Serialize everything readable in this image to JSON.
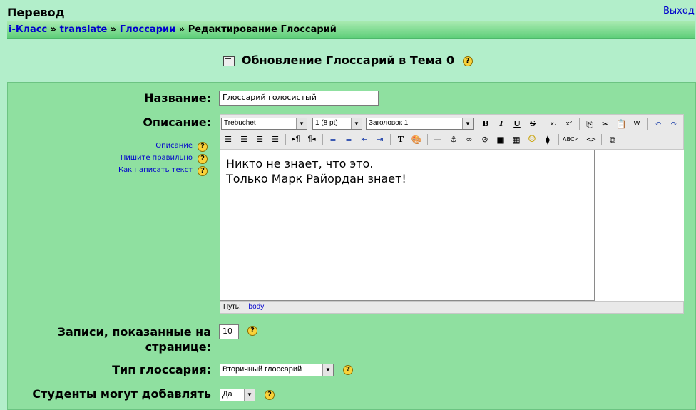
{
  "header": {
    "site_title": "Перевод",
    "logout_label": "Выход"
  },
  "breadcrumb": {
    "items": [
      "i-Класс",
      "translate",
      "Глоссарии"
    ],
    "separator": "»",
    "current": "Редактирование Глоссарий"
  },
  "page": {
    "heading": "Обновление Глоссарий в Тема 0"
  },
  "form": {
    "name_label": "Название:",
    "name_value": "Глоссарий голосистый",
    "description_label": "Описание:",
    "help_links": [
      "Описание",
      "Пишите правильно",
      "Как написать текст"
    ],
    "entries_label_line1": "Записи, показанные на",
    "entries_label_line2": "странице:",
    "entries_value": "10",
    "type_label": "Тип глоссария:",
    "type_value": "Вторичный глоссарий",
    "students_label": "Студенты могут добавлять",
    "students_value": "Да"
  },
  "editor": {
    "font_value": "Trebuchet",
    "size_value": "1 (8 pt)",
    "format_value": "Заголовок 1",
    "content_line1": "Никто не знает, что это.",
    "content_line2": "Только Марк Райордан знает!",
    "path_label": "Путь:",
    "path_value": "body"
  },
  "colors": {
    "page_bg": "#b2eeca",
    "panel_bg": "#8fe0a0",
    "link": "#0000cc",
    "help_icon": "#f9d23a"
  }
}
